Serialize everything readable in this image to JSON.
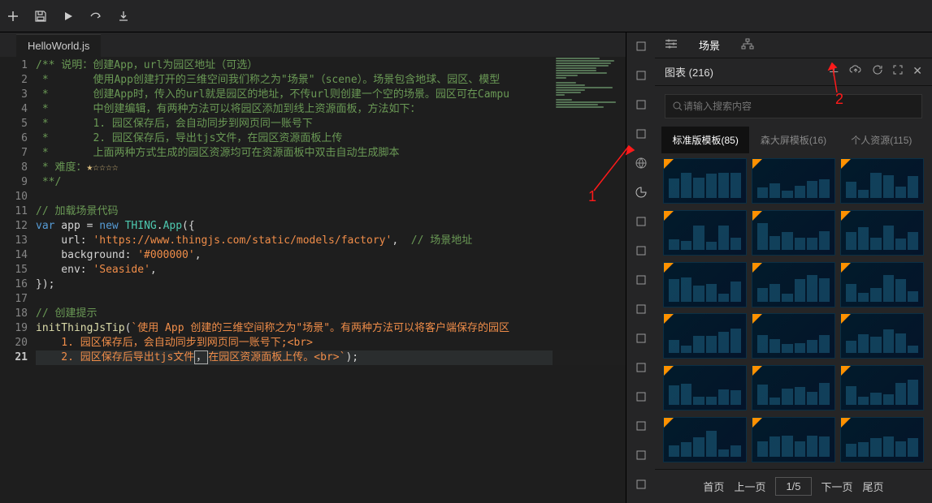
{
  "toolbar_icons": [
    "plus",
    "save",
    "play",
    "share",
    "download"
  ],
  "tab": {
    "label": "HelloWorld.js"
  },
  "code_lines": [
    [
      {
        "cls": "c-comment",
        "t": "/** 说明：创建App，url为园区地址（可选）"
      }
    ],
    [
      {
        "cls": "c-comment",
        "t": " *       使用App创建打开的三维空间我们称之为\"场景\"（scene）。场景包含地球、园区、模型"
      }
    ],
    [
      {
        "cls": "c-comment",
        "t": " *       创建App时，传入的url就是园区的地址，不传url则创建一个空的场景。园区可在Campu"
      }
    ],
    [
      {
        "cls": "c-comment",
        "t": " *       中创建编辑，有两种方法可以将园区添加到线上资源面板，方法如下："
      }
    ],
    [
      {
        "cls": "c-comment",
        "t": " *       1. 园区保存后，会自动同步到网页同一账号下"
      }
    ],
    [
      {
        "cls": "c-comment",
        "t": " *       2. 园区保存后，导出tjs文件，在园区资源面板上传"
      }
    ],
    [
      {
        "cls": "c-comment",
        "t": " *       上面两种方式生成的园区资源均可在资源面板中双击自动生成脚本"
      }
    ],
    [
      {
        "cls": "c-comment",
        "t": " * 难度："
      },
      {
        "cls": "c-star",
        "t": "★☆☆☆☆"
      }
    ],
    [
      {
        "cls": "c-comment",
        "t": " **/"
      }
    ],
    [],
    [
      {
        "cls": "c-comment",
        "t": "// 加载场景代码"
      }
    ],
    [
      {
        "cls": "c-keyword",
        "t": "var"
      },
      {
        "cls": "c-punct",
        "t": " app = "
      },
      {
        "cls": "c-keyword",
        "t": "new"
      },
      {
        "cls": "c-punct",
        "t": " "
      },
      {
        "cls": "c-class",
        "t": "THING"
      },
      {
        "cls": "c-punct",
        "t": "."
      },
      {
        "cls": "c-class",
        "t": "App"
      },
      {
        "cls": "c-punct",
        "t": "({"
      }
    ],
    [
      {
        "cls": "c-punct",
        "t": "    url: "
      },
      {
        "cls": "c-string",
        "t": "'https://www.thingjs.com/static/models/factory'"
      },
      {
        "cls": "c-punct",
        "t": ",  "
      },
      {
        "cls": "c-comment",
        "t": "// 场景地址"
      }
    ],
    [
      {
        "cls": "c-punct",
        "t": "    background: "
      },
      {
        "cls": "c-string",
        "t": "'#000000'"
      },
      {
        "cls": "c-punct",
        "t": ","
      }
    ],
    [
      {
        "cls": "c-punct",
        "t": "    env: "
      },
      {
        "cls": "c-string",
        "t": "'Seaside'"
      },
      {
        "cls": "c-punct",
        "t": ","
      }
    ],
    [
      {
        "cls": "c-punct",
        "t": "});"
      }
    ],
    [],
    [
      {
        "cls": "c-comment",
        "t": "// 创建提示"
      }
    ],
    [
      {
        "cls": "c-func",
        "t": "initThingJsTip"
      },
      {
        "cls": "c-punct",
        "t": "("
      },
      {
        "cls": "c-string",
        "t": "`使用 App 创建的三维空间称之为\"场景\"。有两种方法可以将客户端保存的园区"
      }
    ],
    [
      {
        "cls": "c-string",
        "t": "    1. 园区保存后，会自动同步到网页同一账号下;<br>"
      }
    ],
    [
      {
        "cls": "c-string",
        "t": "    2. 园区保存后导出tjs文件"
      },
      {
        "cls": "cursor-box",
        "t": "，"
      },
      {
        "cls": "c-string",
        "t": "在园区资源面板上传。<br>`"
      },
      {
        "cls": "c-punct",
        "t": ");"
      }
    ]
  ],
  "rail_icons": [
    "sliders",
    "layers",
    "box",
    "cube",
    "globe",
    "chart",
    "network",
    "flag",
    "gear",
    "template",
    "city",
    "image",
    "music",
    "cloud",
    "line-chart",
    "monitor"
  ],
  "panel_tabs": [
    {
      "icon": "sliders",
      "label": ""
    },
    {
      "label": "场景",
      "active": true
    },
    {
      "icon": "tree",
      "label": ""
    }
  ],
  "panel_header": {
    "title_label": "图表",
    "count": "(216)"
  },
  "header_icons": [
    "plus",
    "cloud-up",
    "refresh",
    "expand",
    "close"
  ],
  "search": {
    "placeholder": "请输入搜索内容"
  },
  "template_tabs": [
    {
      "label": "标准版模板(85)",
      "active": true
    },
    {
      "label": "森大屏模板(16)"
    },
    {
      "label": "个人资源(115)"
    }
  ],
  "pager": {
    "first": "首页",
    "prev": "上一页",
    "page": "1/5",
    "next": "下一页",
    "last": "尾页"
  },
  "annotations": {
    "n1": "1",
    "n2": "2"
  }
}
